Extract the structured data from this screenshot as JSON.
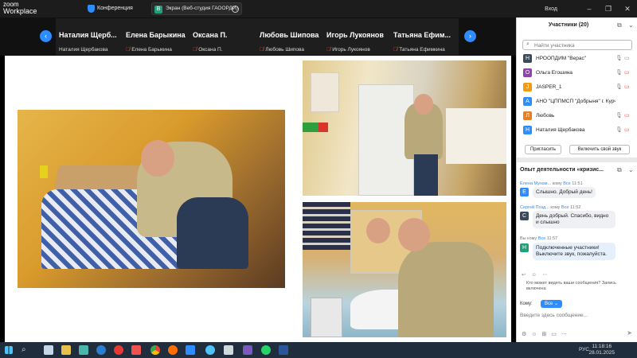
{
  "app": {
    "logo_line1": "zoom",
    "logo_line2": "Workplace",
    "meeting_label": "Конференция",
    "share_badge": "В",
    "share_title": "Экран (Веб-студия ГАООРДИ)",
    "signin": "Вход"
  },
  "strip": {
    "prev": "‹",
    "next": "›",
    "tiles": [
      {
        "big": "Наталия Щерб...",
        "small": "Наталия Щербакова",
        "muted": false
      },
      {
        "big": "Елена Барыкина",
        "small": "Елена Барыкина",
        "muted": true
      },
      {
        "big": "Оксана П.",
        "small": "Оксана П.",
        "muted": true
      },
      {
        "big": "Любовь Шипова",
        "small": "Любовь Шипова",
        "muted": true
      },
      {
        "big": "Игорь Лукоянов",
        "small": "Игорь Лукоянов",
        "muted": true
      },
      {
        "big": "Татьяна Ефим...",
        "small": "Татьяна Ефимкина",
        "muted": true
      }
    ]
  },
  "participants": {
    "title": "Участники (20)",
    "search_placeholder": "Найти участника",
    "list": [
      {
        "initial": "Н",
        "color": "#3b4a5a",
        "name": "НРООПДИМ \"Верас\""
      },
      {
        "initial": "О",
        "color": "#8e44ad",
        "name": "Ольга  Егошина"
      },
      {
        "initial": "J",
        "color": "#f39c12",
        "name": "JASPER_1"
      },
      {
        "initial": "А",
        "color": "#2d8cff",
        "name": "АНО \"ЦППМСП \"Добрыня\" г. Курч..."
      },
      {
        "initial": "Л",
        "color": "#e67e22",
        "name": "Любовь"
      },
      {
        "initial": "Н",
        "color": "#2d8cff",
        "name": "Наталия Щербакова"
      }
    ],
    "invite_label": "Пригласить",
    "unmute_label": "Включить свой звук"
  },
  "chat": {
    "title": "Опыт деятельности «кризис...",
    "messages": [
      {
        "initial": "Е",
        "color": "#2d8cff",
        "from": "Елена Мухам...",
        "to_word": "кому",
        "to": "Все",
        "time": "11:51",
        "text": "Слышно. Добрый день!"
      },
      {
        "initial": "С",
        "color": "#3b4a5a",
        "from": "Сергей Позд...",
        "to_word": "кому",
        "to": "Все",
        "time": "11:52",
        "text": "День добрый. Спасибо, видно и слышно"
      },
      {
        "initial": "Н",
        "color": "#21a17a",
        "from": "Вы",
        "to_word": "кому",
        "to": "Все",
        "time": "11:57",
        "text": "Подключенные участники! Выключите звук, пожалуйста."
      }
    ],
    "visibility_hint": "Кто может видеть ваши сообщения? Запись включена",
    "to_label": "Кому:",
    "to_value": "Все ⌄",
    "input_placeholder": "Введите здесь сообщение..."
  },
  "taskbar": {
    "lang": "РУС",
    "time": "11:18:16",
    "date": "28.01.2025"
  }
}
